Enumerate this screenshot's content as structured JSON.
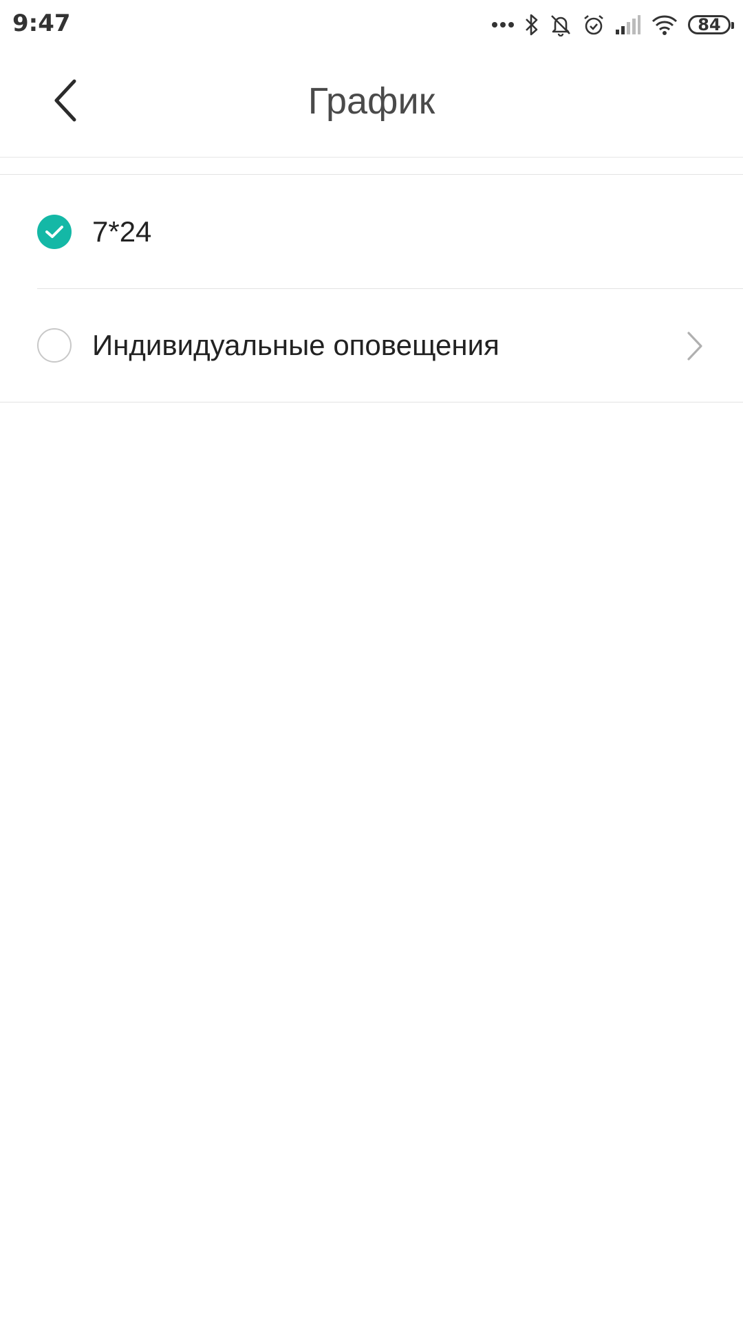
{
  "status_bar": {
    "time": "9:47",
    "battery_level": "84",
    "icons": [
      "more-dots-icon",
      "bluetooth-icon",
      "silent-bell-icon",
      "alarm-icon",
      "signal-icon",
      "wifi-icon",
      "battery-icon"
    ]
  },
  "header": {
    "title": "График",
    "back_icon": "chevron-left-icon"
  },
  "schedule_options": [
    {
      "label": "7*24",
      "selected": true
    },
    {
      "label": "Индивидуальные оповещения",
      "selected": false,
      "has_chevron": true
    }
  ],
  "colors": {
    "accent": "#14b8a6",
    "text": "#222222",
    "title": "#4a4a4a",
    "divider": "#e2e2e2"
  }
}
